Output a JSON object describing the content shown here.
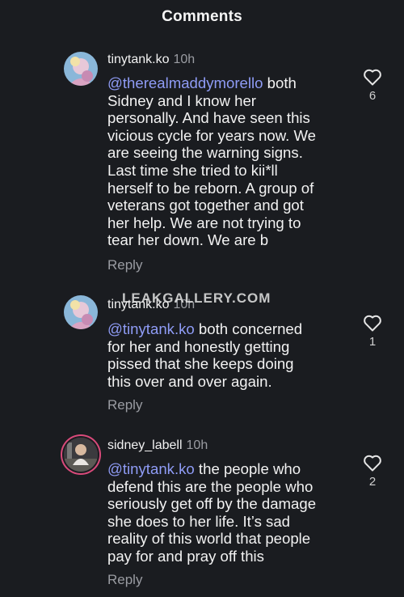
{
  "header": {
    "title": "Comments"
  },
  "watermark": "LEAKGALLERY.COM",
  "comments": [
    {
      "username": "tinytank.ko",
      "time": "10h",
      "mention": "@therealmaddymorello",
      "text_lines": [
        " both",
        "Sidney and I know her",
        "personally. And have seen this",
        "vicious cycle for years now. We",
        "are seeing the warning signs.",
        "Last time she tried to kii*ll",
        "herself to be reborn. A group of",
        "veterans got together and got",
        "her help. We are not trying to",
        "tear her down. We are b"
      ],
      "reply_label": "Reply",
      "likes": "6",
      "like_icon": "heart-outline-icon"
    },
    {
      "username": "tinytank.ko",
      "time": "10h",
      "mention": "@tinytank.ko",
      "text_lines": [
        " both concerned",
        "for her and honestly getting",
        "pissed that she keeps doing",
        "this over and over again."
      ],
      "reply_label": "Reply",
      "likes": "1",
      "like_icon": "heart-outline-icon"
    },
    {
      "username": "sidney_labell",
      "time": "10h",
      "mention": "@tinytank.ko",
      "text_lines": [
        " the people who",
        "defend this are the people who",
        "seriously get off by the damage",
        "she does to her life. It’s sad",
        "reality of this world that people",
        "pay for and pray off this"
      ],
      "reply_label": "Reply",
      "likes": "2",
      "like_icon": "heart-outline-icon"
    }
  ],
  "colors": {
    "background": "#1a1c20",
    "text": "#f2f2f2",
    "muted": "#9a9ca2",
    "mention": "#8f9cf6",
    "story_ring": "#d94a7a"
  }
}
